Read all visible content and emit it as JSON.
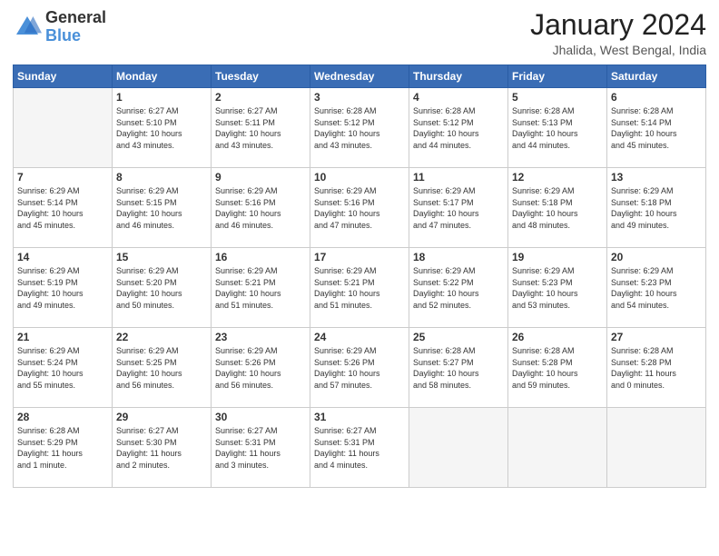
{
  "header": {
    "logo_general": "General",
    "logo_blue": "Blue",
    "month_title": "January 2024",
    "subtitle": "Jhalida, West Bengal, India"
  },
  "days_of_week": [
    "Sunday",
    "Monday",
    "Tuesday",
    "Wednesday",
    "Thursday",
    "Friday",
    "Saturday"
  ],
  "weeks": [
    [
      {
        "day": "",
        "info": ""
      },
      {
        "day": "1",
        "info": "Sunrise: 6:27 AM\nSunset: 5:10 PM\nDaylight: 10 hours\nand 43 minutes."
      },
      {
        "day": "2",
        "info": "Sunrise: 6:27 AM\nSunset: 5:11 PM\nDaylight: 10 hours\nand 43 minutes."
      },
      {
        "day": "3",
        "info": "Sunrise: 6:28 AM\nSunset: 5:12 PM\nDaylight: 10 hours\nand 43 minutes."
      },
      {
        "day": "4",
        "info": "Sunrise: 6:28 AM\nSunset: 5:12 PM\nDaylight: 10 hours\nand 44 minutes."
      },
      {
        "day": "5",
        "info": "Sunrise: 6:28 AM\nSunset: 5:13 PM\nDaylight: 10 hours\nand 44 minutes."
      },
      {
        "day": "6",
        "info": "Sunrise: 6:28 AM\nSunset: 5:14 PM\nDaylight: 10 hours\nand 45 minutes."
      }
    ],
    [
      {
        "day": "7",
        "info": "Sunrise: 6:29 AM\nSunset: 5:14 PM\nDaylight: 10 hours\nand 45 minutes."
      },
      {
        "day": "8",
        "info": "Sunrise: 6:29 AM\nSunset: 5:15 PM\nDaylight: 10 hours\nand 46 minutes."
      },
      {
        "day": "9",
        "info": "Sunrise: 6:29 AM\nSunset: 5:16 PM\nDaylight: 10 hours\nand 46 minutes."
      },
      {
        "day": "10",
        "info": "Sunrise: 6:29 AM\nSunset: 5:16 PM\nDaylight: 10 hours\nand 47 minutes."
      },
      {
        "day": "11",
        "info": "Sunrise: 6:29 AM\nSunset: 5:17 PM\nDaylight: 10 hours\nand 47 minutes."
      },
      {
        "day": "12",
        "info": "Sunrise: 6:29 AM\nSunset: 5:18 PM\nDaylight: 10 hours\nand 48 minutes."
      },
      {
        "day": "13",
        "info": "Sunrise: 6:29 AM\nSunset: 5:18 PM\nDaylight: 10 hours\nand 49 minutes."
      }
    ],
    [
      {
        "day": "14",
        "info": "Sunrise: 6:29 AM\nSunset: 5:19 PM\nDaylight: 10 hours\nand 49 minutes."
      },
      {
        "day": "15",
        "info": "Sunrise: 6:29 AM\nSunset: 5:20 PM\nDaylight: 10 hours\nand 50 minutes."
      },
      {
        "day": "16",
        "info": "Sunrise: 6:29 AM\nSunset: 5:21 PM\nDaylight: 10 hours\nand 51 minutes."
      },
      {
        "day": "17",
        "info": "Sunrise: 6:29 AM\nSunset: 5:21 PM\nDaylight: 10 hours\nand 51 minutes."
      },
      {
        "day": "18",
        "info": "Sunrise: 6:29 AM\nSunset: 5:22 PM\nDaylight: 10 hours\nand 52 minutes."
      },
      {
        "day": "19",
        "info": "Sunrise: 6:29 AM\nSunset: 5:23 PM\nDaylight: 10 hours\nand 53 minutes."
      },
      {
        "day": "20",
        "info": "Sunrise: 6:29 AM\nSunset: 5:23 PM\nDaylight: 10 hours\nand 54 minutes."
      }
    ],
    [
      {
        "day": "21",
        "info": "Sunrise: 6:29 AM\nSunset: 5:24 PM\nDaylight: 10 hours\nand 55 minutes."
      },
      {
        "day": "22",
        "info": "Sunrise: 6:29 AM\nSunset: 5:25 PM\nDaylight: 10 hours\nand 56 minutes."
      },
      {
        "day": "23",
        "info": "Sunrise: 6:29 AM\nSunset: 5:26 PM\nDaylight: 10 hours\nand 56 minutes."
      },
      {
        "day": "24",
        "info": "Sunrise: 6:29 AM\nSunset: 5:26 PM\nDaylight: 10 hours\nand 57 minutes."
      },
      {
        "day": "25",
        "info": "Sunrise: 6:28 AM\nSunset: 5:27 PM\nDaylight: 10 hours\nand 58 minutes."
      },
      {
        "day": "26",
        "info": "Sunrise: 6:28 AM\nSunset: 5:28 PM\nDaylight: 10 hours\nand 59 minutes."
      },
      {
        "day": "27",
        "info": "Sunrise: 6:28 AM\nSunset: 5:28 PM\nDaylight: 11 hours\nand 0 minutes."
      }
    ],
    [
      {
        "day": "28",
        "info": "Sunrise: 6:28 AM\nSunset: 5:29 PM\nDaylight: 11 hours\nand 1 minute."
      },
      {
        "day": "29",
        "info": "Sunrise: 6:27 AM\nSunset: 5:30 PM\nDaylight: 11 hours\nand 2 minutes."
      },
      {
        "day": "30",
        "info": "Sunrise: 6:27 AM\nSunset: 5:31 PM\nDaylight: 11 hours\nand 3 minutes."
      },
      {
        "day": "31",
        "info": "Sunrise: 6:27 AM\nSunset: 5:31 PM\nDaylight: 11 hours\nand 4 minutes."
      },
      {
        "day": "",
        "info": ""
      },
      {
        "day": "",
        "info": ""
      },
      {
        "day": "",
        "info": ""
      }
    ]
  ]
}
